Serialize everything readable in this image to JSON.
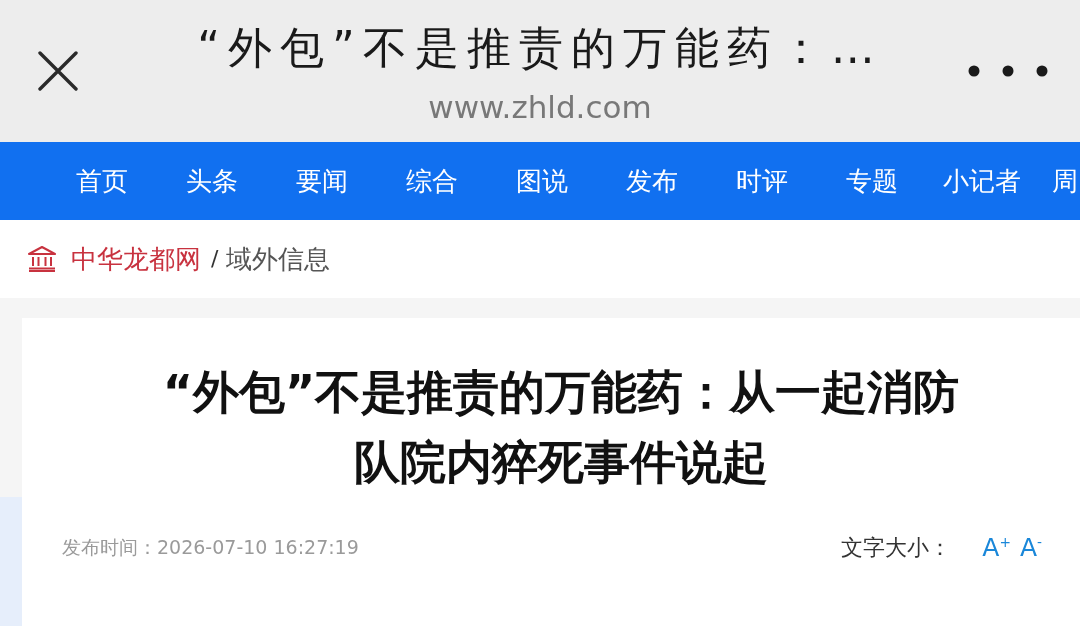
{
  "top_bar": {
    "title": "“外包”不是推责的万能药：…",
    "url": "www.zhld.com"
  },
  "nav": {
    "items": [
      "首页",
      "头条",
      "要闻",
      "综合",
      "图说",
      "发布",
      "时评",
      "专题",
      "小记者",
      "周"
    ]
  },
  "breadcrumb": {
    "site": "中华龙都网",
    "separator": "/",
    "section": "域外信息"
  },
  "article": {
    "headline": "“外包”不是推责的万能药：从一起消防队院内猝死事件说起",
    "published": "发布时间：2026-07-10 16:27:19",
    "font_size": {
      "label": "文字大小：",
      "buttons": [
        "A$^{+}$",
        "A$^{-}$"
      ]
    }
  }
}
